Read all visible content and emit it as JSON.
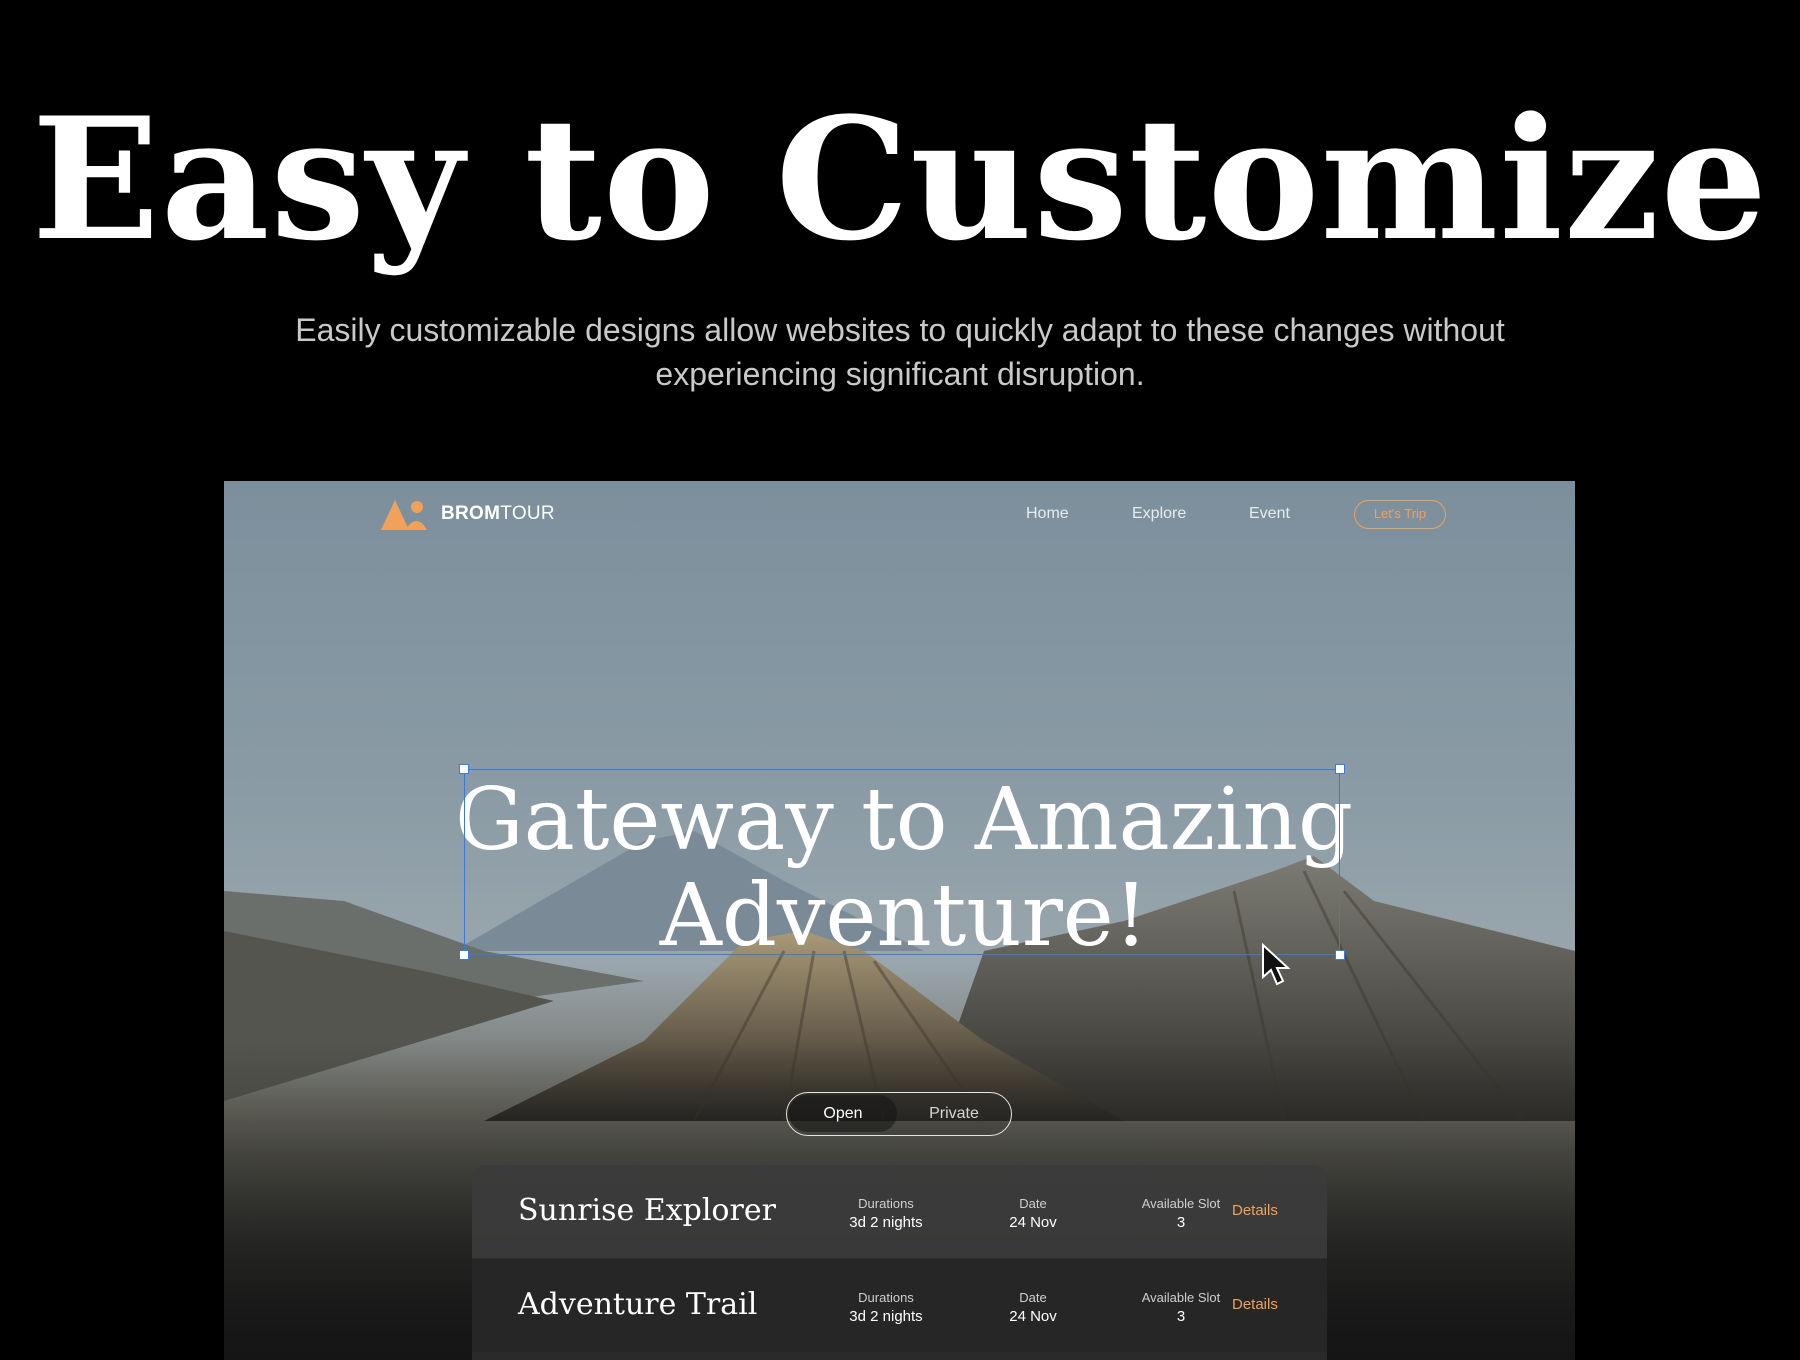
{
  "heading": {
    "title": "Easy to Customize",
    "subtitle": "Easily customizable designs allow websites to quickly adapt to these changes without experiencing significant disruption."
  },
  "preview": {
    "brand": {
      "part1": "BROM",
      "part2": "TOUR",
      "logo_icon": "mountain-logo-icon"
    },
    "nav": [
      "Home",
      "Explore",
      "Event"
    ],
    "cta_label": "Let's Trip",
    "hero_title": "Gateway to Amazing Adventure!",
    "toggle": {
      "open": "Open",
      "private": "Private"
    },
    "trips": [
      {
        "name": "Sunrise Explorer",
        "duration_label": "Durations",
        "duration": "3d 2 nights",
        "date_label": "Date",
        "date": "24 Nov",
        "slot_label": "Available Slot",
        "slot": "3",
        "details_label": "Details"
      },
      {
        "name": "Adventure Trail",
        "duration_label": "Durations",
        "duration": "3d 2 nights",
        "date_label": "Date",
        "date": "24 Nov",
        "slot_label": "Available Slot",
        "slot": "3",
        "details_label": "Details"
      }
    ],
    "colors": {
      "accent": "#f0a15b",
      "selection": "#3c7ad8"
    }
  }
}
